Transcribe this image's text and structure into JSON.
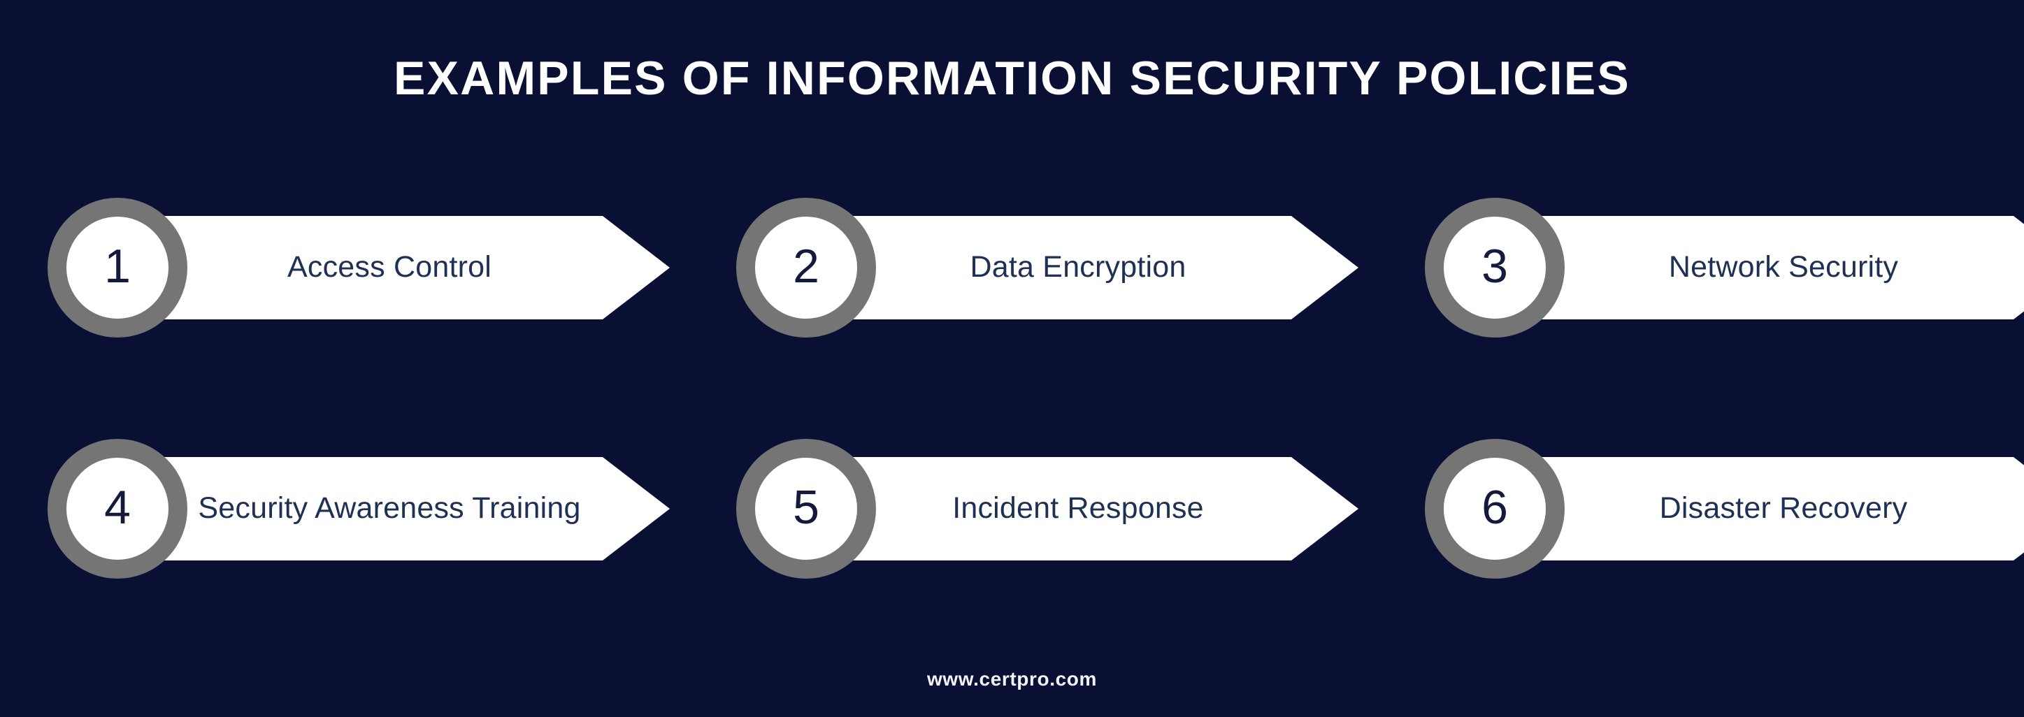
{
  "colors": {
    "background": "#0a1033",
    "arrow_fill": "#ffffff",
    "ring": "#757575",
    "label_text": "#1e3054",
    "number_text": "#141a3c",
    "title_text": "#ffffff",
    "footer_text": "#f2f3f8"
  },
  "header": {
    "title": "EXAMPLES OF INFORMATION SECURITY POLICIES"
  },
  "items": [
    {
      "number": "1",
      "label": "Access Control"
    },
    {
      "number": "2",
      "label": "Data Encryption"
    },
    {
      "number": "3",
      "label": "Network Security"
    },
    {
      "number": "4",
      "label": "Security Awareness Training"
    },
    {
      "number": "5",
      "label": "Incident Response"
    },
    {
      "number": "6",
      "label": "Disaster Recovery"
    }
  ],
  "footer": {
    "website": "www.certpro.com"
  }
}
